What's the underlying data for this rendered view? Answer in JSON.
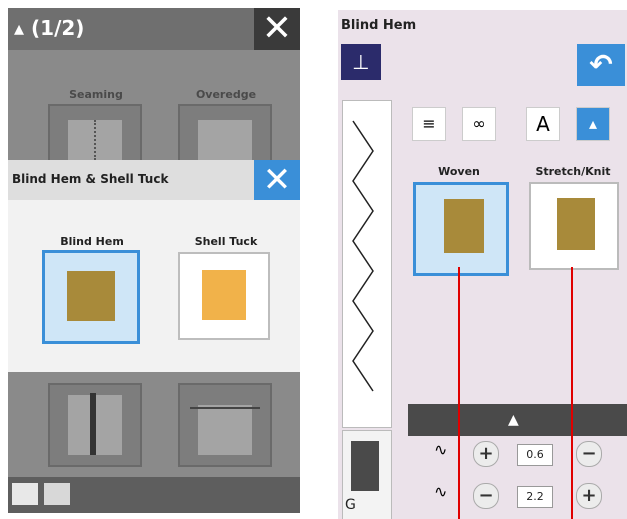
{
  "left_panel": {
    "header_title": "(1/2)",
    "header_icon": "shirt-icon",
    "background_labels": [
      "Seaming",
      "Overedge"
    ],
    "popup": {
      "title": "Blind Hem & Shell Tuck",
      "options": [
        {
          "label": "Blind Hem",
          "selected": true
        },
        {
          "label": "Shell Tuck",
          "selected": false
        }
      ]
    }
  },
  "right_panel": {
    "title": "Blind Hem",
    "mode_button": "B",
    "tabs": [
      "utility-stitch-icon",
      "decorative-stitch-icon",
      "A",
      "shirt-icon"
    ],
    "options": [
      {
        "label": "Woven",
        "selected": true
      },
      {
        "label": "Stretch/Knit",
        "selected": false
      }
    ],
    "settings": [
      {
        "value": "0.6"
      },
      {
        "value": "2.2"
      }
    ],
    "foot_label": "G"
  },
  "colors": {
    "accent": "#3a8fd8",
    "annotation_line": "#e00000"
  }
}
